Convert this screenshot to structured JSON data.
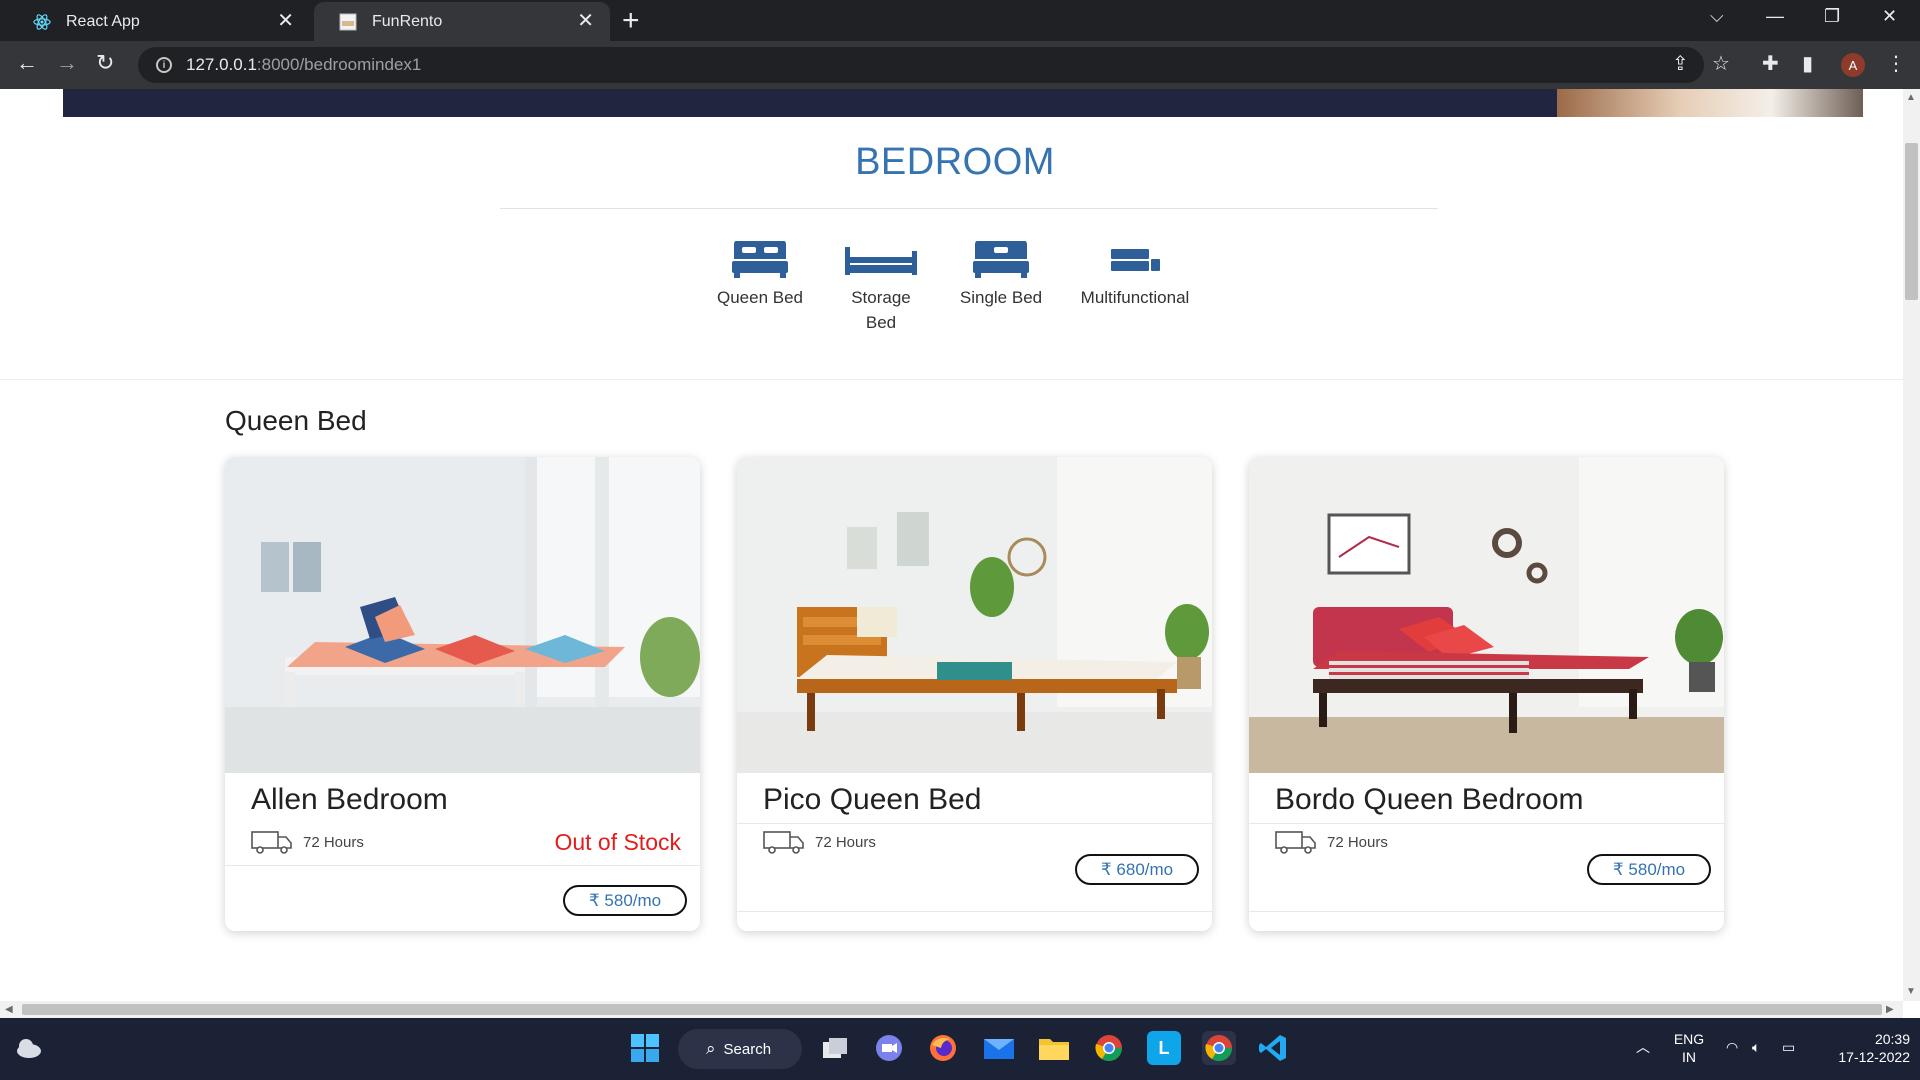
{
  "browser": {
    "tabs": [
      {
        "title": "React App"
      },
      {
        "title": "FunRento"
      }
    ],
    "url_host": "127.0.0.1",
    "url_path": ":8000/bedroomindex1",
    "profile_initial": "A"
  },
  "page": {
    "heading": "BEDROOM",
    "categories": [
      {
        "label": "Queen Bed",
        "icon": "queen-bed-icon"
      },
      {
        "label": "Storage",
        "label2": "Bed",
        "icon": "storage-bed-icon"
      },
      {
        "label": "Single Bed",
        "icon": "single-bed-icon"
      },
      {
        "label": "Multifunctional",
        "icon": "multifunctional-bed-icon"
      }
    ],
    "section_title": "Queen Bed",
    "products": [
      {
        "name": "Allen Bedroom",
        "delivery": "72 Hours",
        "stock": "Out of Stock",
        "price": "₹ 580/mo"
      },
      {
        "name": "Pico Queen Bed",
        "delivery": "72 Hours",
        "stock": "",
        "price": "₹ 680/mo"
      },
      {
        "name": "Bordo Queen Bedroom",
        "delivery": "72 Hours",
        "stock": "",
        "price": "₹ 580/mo"
      }
    ]
  },
  "taskbar": {
    "search_label": "Search",
    "lang_top": "ENG",
    "lang_bottom": "IN",
    "time": "20:39",
    "date": "17-12-2022"
  },
  "colors": {
    "accent": "#3573b2",
    "out_of_stock": "#e51c1c",
    "hero_band": "#22253f"
  }
}
